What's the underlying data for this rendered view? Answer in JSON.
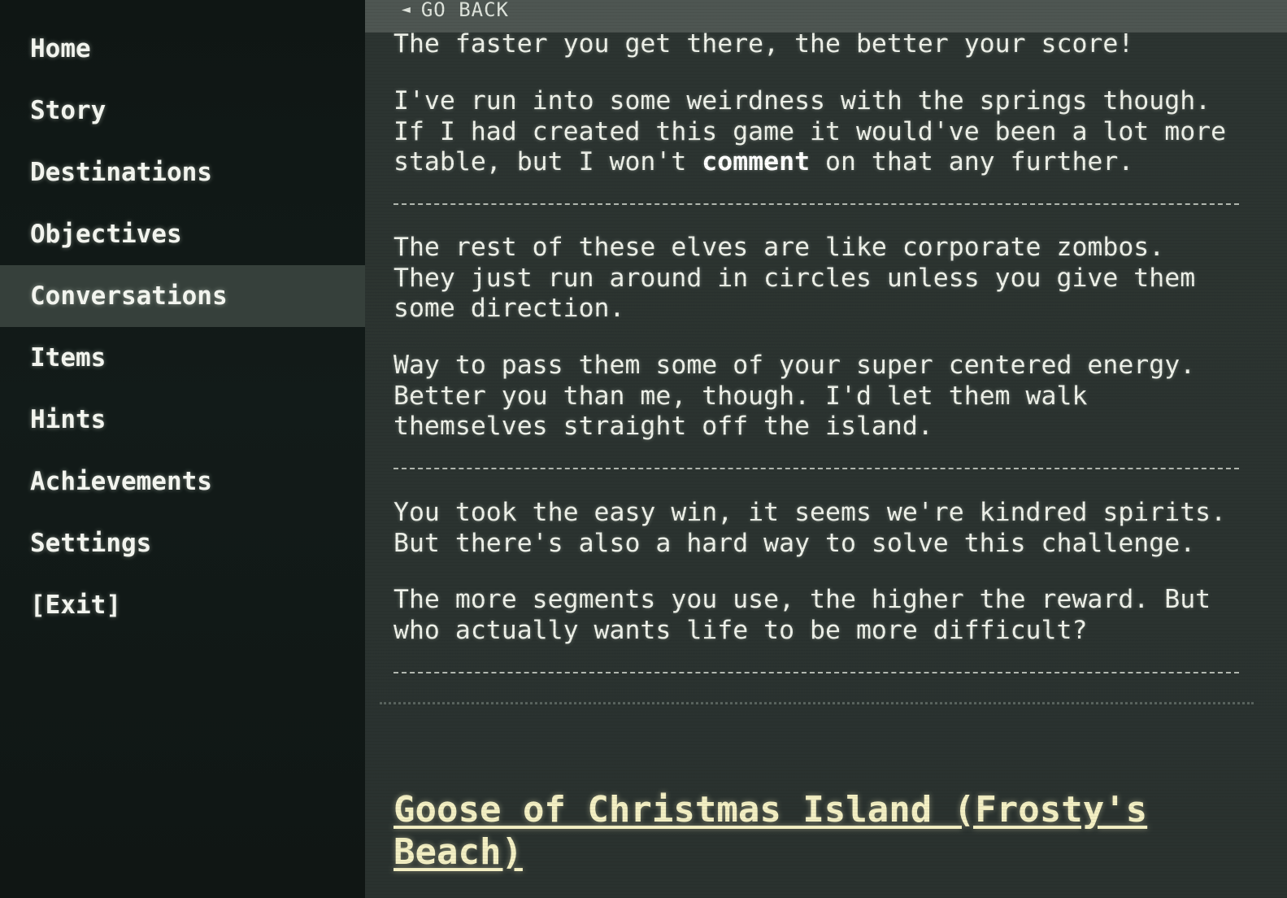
{
  "sidebar": {
    "items": [
      {
        "label": "Home"
      },
      {
        "label": "Story"
      },
      {
        "label": "Destinations"
      },
      {
        "label": "Objectives"
      },
      {
        "label": "Conversations",
        "active": true
      },
      {
        "label": "Items"
      },
      {
        "label": "Hints"
      },
      {
        "label": "Achievements"
      },
      {
        "label": "Settings"
      },
      {
        "label": "[Exit]"
      }
    ]
  },
  "header": {
    "back_arrow": "◄",
    "back_label": "GO BACK"
  },
  "conversation": {
    "p1": "The faster you get there, the better your score!",
    "p2_before": "I've run into some weirdness with the springs though.\nIf I had created this game it would've been a lot more\nstable, but I won't ",
    "p2_bold": "comment",
    "p2_after": " on that any further.",
    "p3": "The rest of these elves are like corporate zombos.\nThey just run around in circles unless you give them\nsome direction.",
    "p4": "Way to pass them some of your super centered energy.\nBetter you than me, though. I'd let them walk\nthemselves straight off the island.",
    "p5": "You took the easy win, it seems we're kindred spirits.\nBut there's also a hard way to solve this challenge.",
    "p6": "The more segments you use, the higher the reward. But\nwho actually wants life to be more difficult?"
  },
  "next_section": {
    "title": "Goose of Christmas Island (Frosty's Beach)"
  },
  "colors": {
    "sidebar_bg": "#111917",
    "active_item_bg": "#36403b",
    "content_bg": "#2c3431",
    "title_color": "#f3efc3"
  }
}
